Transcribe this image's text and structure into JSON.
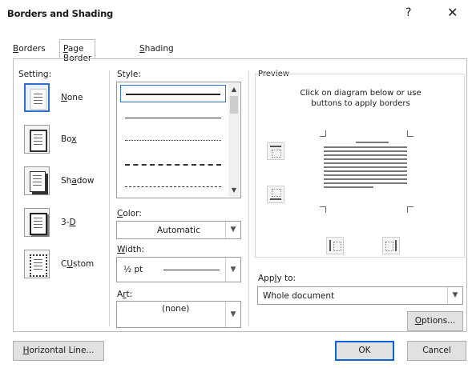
{
  "window": {
    "title": "Borders and Shading",
    "help": "?",
    "close": "✕"
  },
  "tabs": [
    {
      "label": "Borders",
      "mnemonic": "B",
      "rest": "orders",
      "active": false
    },
    {
      "label": "Page Border",
      "mnemonic": "P",
      "rest": "age Border",
      "active": true
    },
    {
      "label": "Shading",
      "mnemonic": "S",
      "rest": "hading",
      "active": false
    }
  ],
  "setting": {
    "label": "Setting:",
    "items": [
      {
        "label": "None",
        "mnemonic": "N",
        "rest": "one",
        "selected": true,
        "icon": "none-setting-icon"
      },
      {
        "label": "Box",
        "pre": "Bo",
        "mnemonic": "x",
        "rest": "",
        "selected": false,
        "icon": "box-setting-icon"
      },
      {
        "label": "Shadow",
        "pre": "Sh",
        "mnemonic": "a",
        "rest": "dow",
        "selected": false,
        "icon": "shadow-setting-icon"
      },
      {
        "label": "3-D",
        "pre": "3-",
        "mnemonic": "D",
        "rest": "",
        "selected": false,
        "icon": "3d-setting-icon"
      },
      {
        "label": "Custom",
        "mnemonic": "U",
        "pre": "C",
        "rest": "stom",
        "selected": false,
        "icon": "custom-setting-icon"
      }
    ]
  },
  "style": {
    "label": "Style:",
    "items": [
      "solid-thick",
      "solid-thin",
      "dotted",
      "dashed",
      "dash-dot"
    ],
    "selected_index": 0
  },
  "color": {
    "label": "Color:",
    "value": "Automatic"
  },
  "width": {
    "label": "Width:",
    "value": "½ pt"
  },
  "art": {
    "label": "Art:",
    "value": "(none)"
  },
  "preview": {
    "label": "Preview",
    "instructions_line1": "Click on diagram below or use",
    "instructions_line2": "buttons to apply borders"
  },
  "apply_to": {
    "label": "Apply to:",
    "value": "Whole document"
  },
  "buttons": {
    "options": "Options...",
    "horizontal_line": "Horizontal Line...",
    "ok": "OK",
    "cancel": "Cancel"
  },
  "colors": {
    "accent": "#2f6fd0",
    "default_button_border": "#0a64d8"
  }
}
